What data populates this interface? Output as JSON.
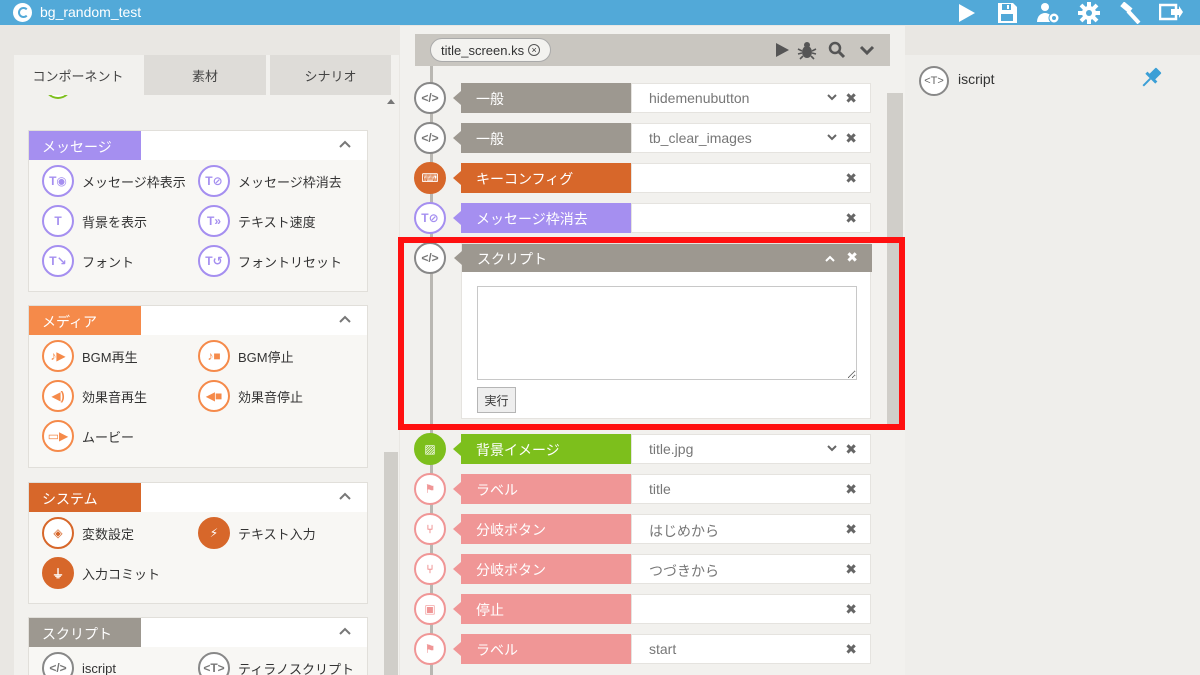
{
  "app": {
    "title": "bg_random_test",
    "toolbar_icons": [
      "play-icon",
      "save-icon",
      "user-settings-icon",
      "gear-icon",
      "hammer-icon",
      "exit-icon"
    ]
  },
  "left_panel": {
    "tabs": [
      {
        "label": "コンポーネント",
        "active": true
      },
      {
        "label": "素材",
        "active": false
      },
      {
        "label": "シナリオ",
        "active": false
      }
    ],
    "sections": {
      "message": {
        "title": "メッセージ",
        "color": "#a58ff0",
        "items": [
          "メッセージ枠表示",
          "メッセージ枠消去",
          "背景を表示",
          "テキスト速度",
          "フォント",
          "フォントリセット"
        ]
      },
      "media": {
        "title": "メディア",
        "color": "#f58a4a",
        "items": [
          "BGM再生",
          "BGM停止",
          "効果音再生",
          "効果音停止",
          "ムービー"
        ]
      },
      "system": {
        "title": "システム",
        "color": "#d7672a",
        "items": [
          "変数設定",
          "テキスト入力",
          "入力コミット"
        ]
      },
      "script": {
        "title": "スクリプト",
        "color": "#9d9890",
        "items": [
          "iscript",
          "ティラノスクリプト"
        ]
      }
    }
  },
  "center_panel": {
    "file_tab": "title_screen.ks",
    "rows": [
      {
        "label": "一般",
        "value": "hidemenubutton",
        "color": "#9d9890",
        "dropdown": true
      },
      {
        "label": "一般",
        "value": "tb_clear_images",
        "color": "#9d9890",
        "dropdown": true
      },
      {
        "label": "キーコンフィグ",
        "value": "",
        "color": "#d7672a",
        "dropdown": false
      },
      {
        "label": "メッセージ枠消去",
        "value": "",
        "color": "#a58ff0",
        "dropdown": false
      }
    ],
    "script_block": {
      "label": "スクリプト",
      "content": "",
      "exec_label": "実行"
    },
    "rows_after": [
      {
        "label": "背景イメージ",
        "value": "title.jpg",
        "color": "#7dbf1c",
        "dropdown": true
      },
      {
        "label": "ラベル",
        "value": "title",
        "color": "#f09696",
        "dropdown": false
      },
      {
        "label": "分岐ボタン",
        "value": "はじめから",
        "color": "#f09696",
        "dropdown": false
      },
      {
        "label": "分岐ボタン",
        "value": "つづきから",
        "color": "#f09696",
        "dropdown": false
      },
      {
        "label": "停止",
        "value": "",
        "color": "#f09696",
        "dropdown": false
      },
      {
        "label": "ラベル",
        "value": "start",
        "color": "#f09696",
        "dropdown": false
      }
    ]
  },
  "right_panel": {
    "title": "iscript"
  },
  "colors": {
    "titlebar": "#52a9d8",
    "highlight": "#ff1010",
    "pin": "#3b9fd6"
  }
}
